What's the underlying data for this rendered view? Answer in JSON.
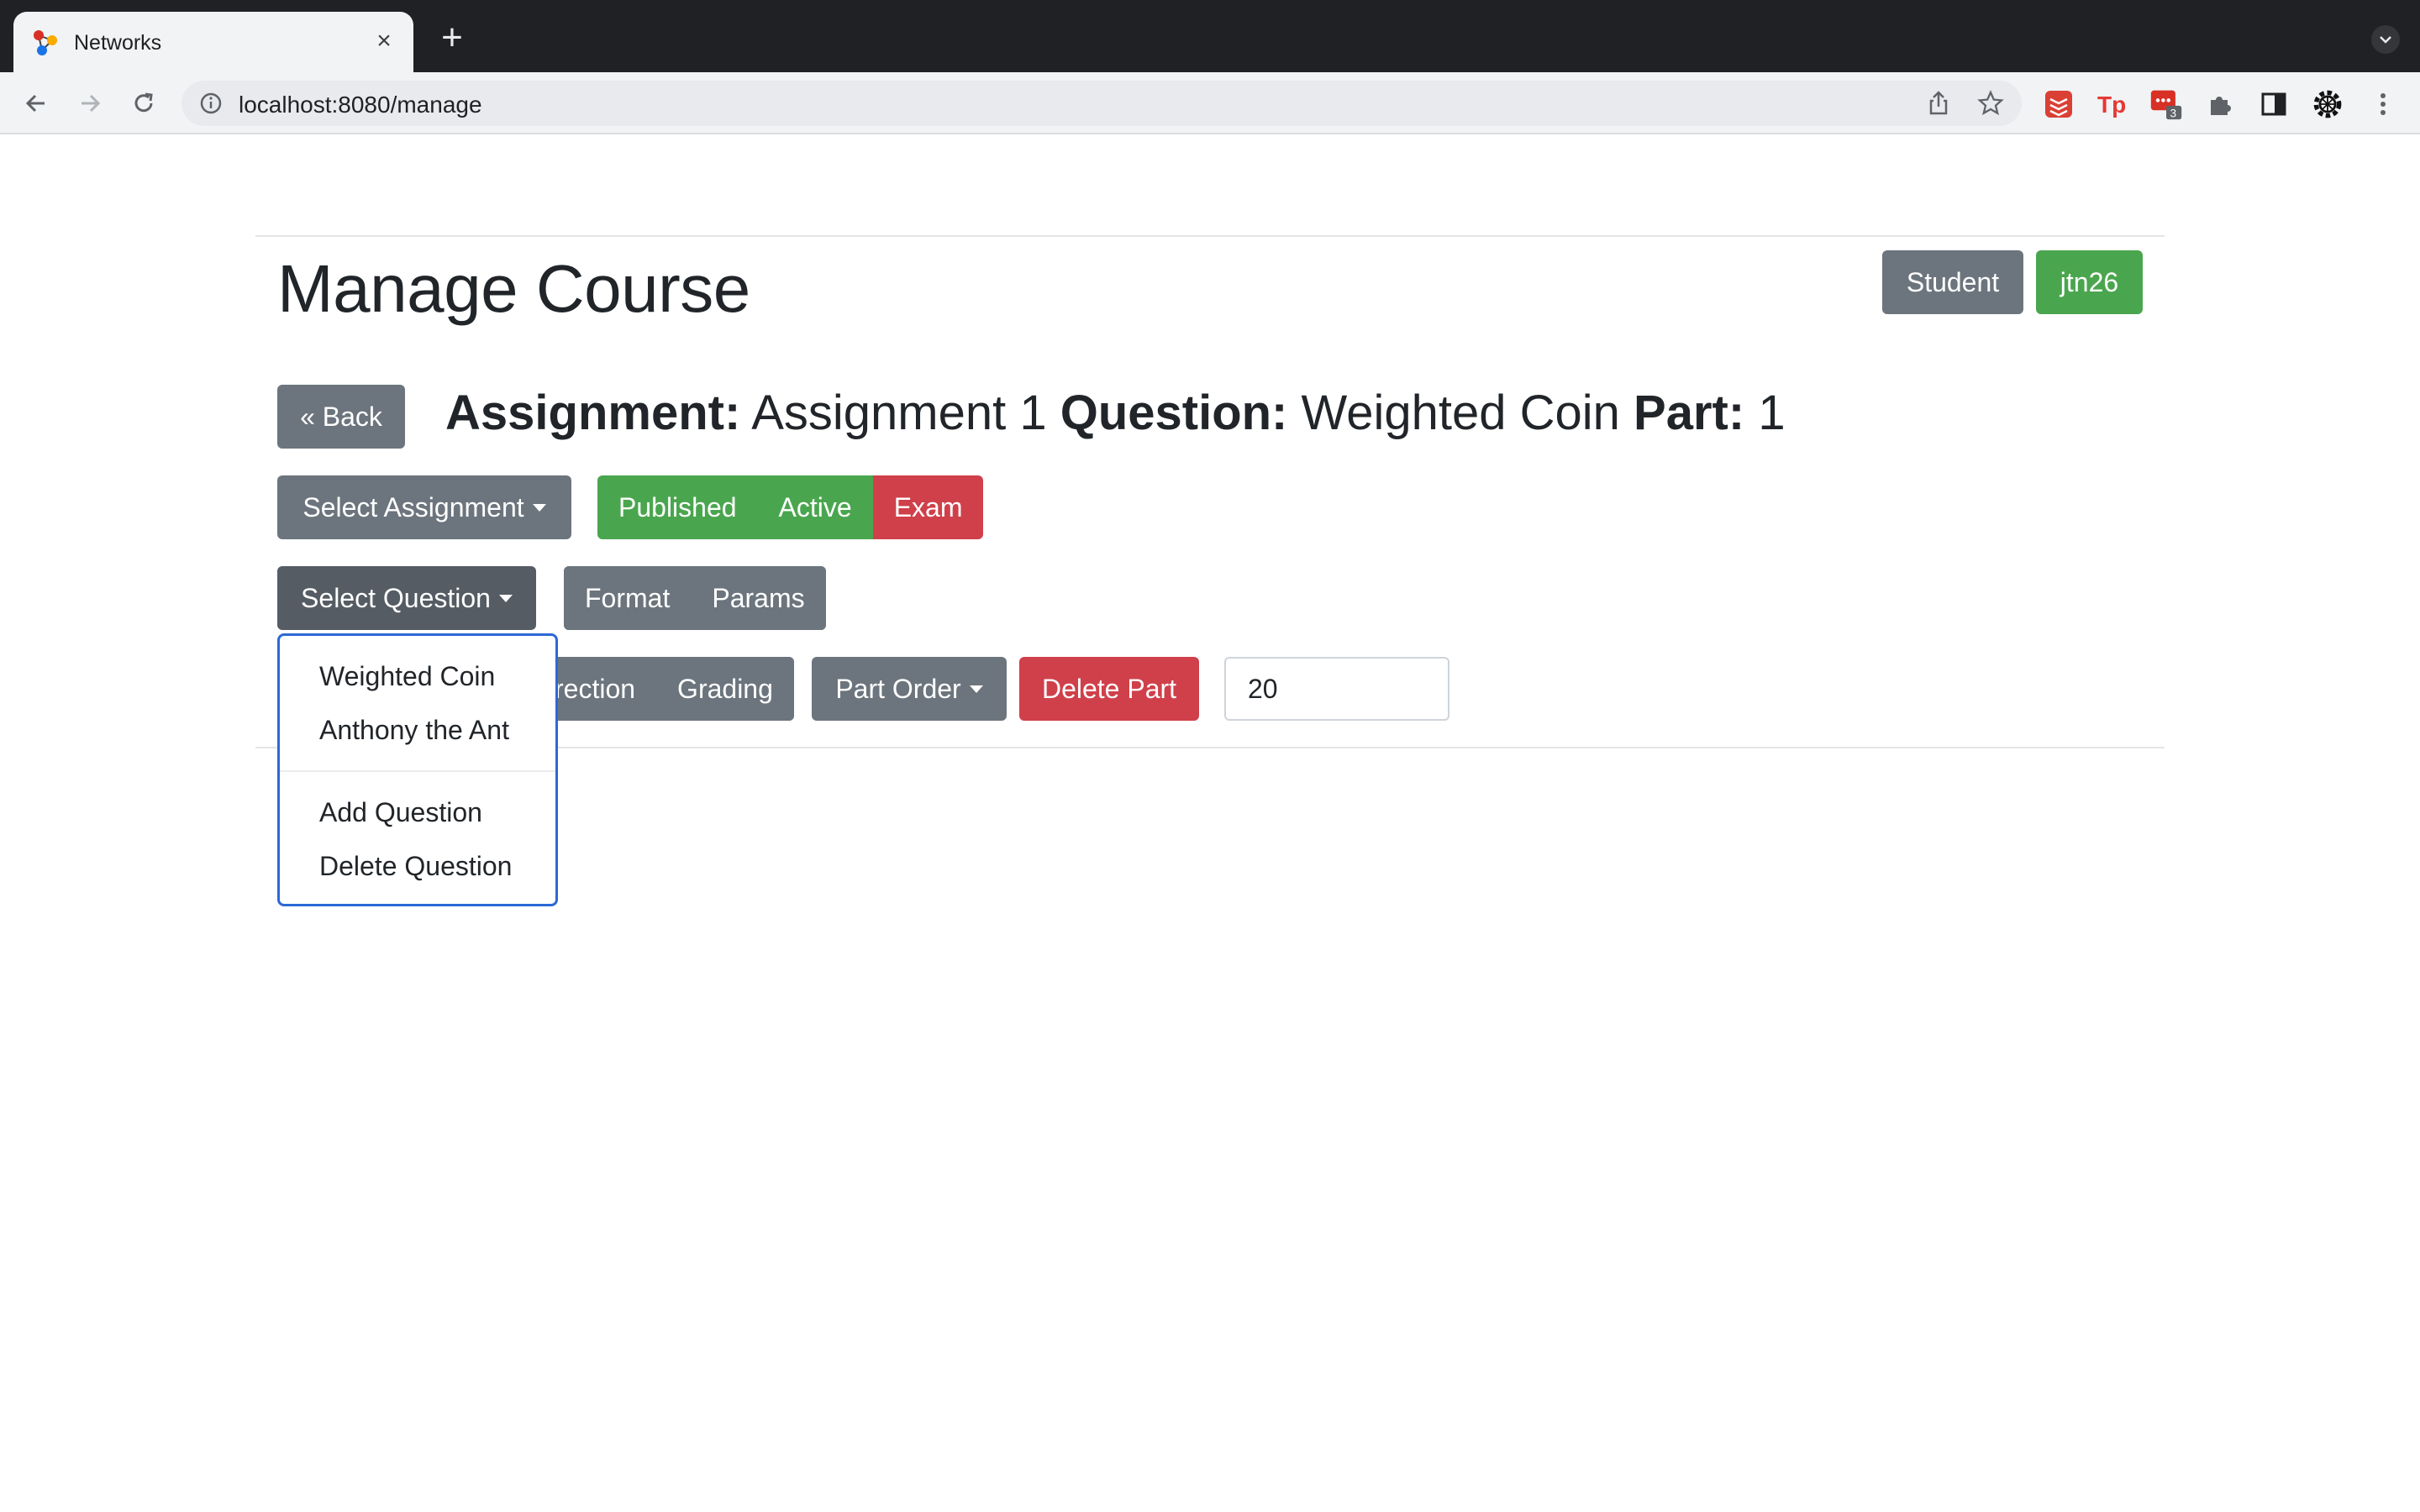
{
  "browser": {
    "tab_title": "Networks",
    "url": "localhost:8080/manage",
    "extension_badge": "3"
  },
  "page": {
    "title": "Manage Course",
    "role_button": "Student",
    "user_button": "jtn26"
  },
  "breadcrumb": {
    "back_label": "« Back",
    "assignment_label": "Assignment:",
    "assignment_value": "Assignment 1",
    "question_label": "Question:",
    "question_value": "Weighted Coin",
    "part_label": "Part:",
    "part_value": "1"
  },
  "assignment_row": {
    "select_label": "Select Assignment",
    "published_label": "Published",
    "active_label": "Active",
    "exam_label": "Exam"
  },
  "question_row": {
    "select_label": "Select Question",
    "format_label": "Format",
    "params_label": "Params"
  },
  "part_row": {
    "direction_label_visible": "rection",
    "grading_label": "Grading",
    "part_order_label": "Part Order",
    "delete_part_label": "Delete Part",
    "points_value": "20"
  },
  "question_dropdown": {
    "items": [
      "Weighted Coin",
      "Anthony the Ant"
    ],
    "actions": [
      "Add Question",
      "Delete Question"
    ]
  },
  "colors": {
    "secondary": "#6c757d",
    "success": "#4aa64e",
    "danger": "#d0404a",
    "focus": "#2c68d6"
  }
}
